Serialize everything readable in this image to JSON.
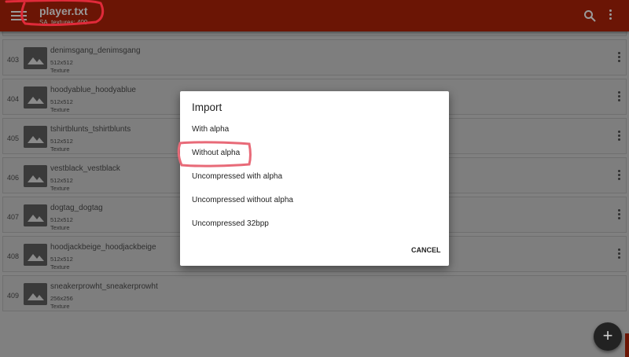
{
  "app_bar": {
    "title": "player.txt",
    "subtitle": "SA_textures: 409",
    "background": "#6b1505"
  },
  "icons": {
    "menu": "menu-icon",
    "search": "search-icon",
    "overflow": "more-vert-icon",
    "thumbnail": "image-icon",
    "fab": "add-icon"
  },
  "items": [
    {
      "index": "403",
      "name": "denimsgang_denimsgang",
      "size": "512x512",
      "type": "Texture"
    },
    {
      "index": "404",
      "name": "hoodyablue_hoodyablue",
      "size": "512x512",
      "type": "Texture"
    },
    {
      "index": "405",
      "name": "tshirtblunts_tshirtblunts",
      "size": "512x512",
      "type": "Texture"
    },
    {
      "index": "406",
      "name": "vestblack_vestblack",
      "size": "512x512",
      "type": "Texture"
    },
    {
      "index": "407",
      "name": "dogtag_dogtag",
      "size": "512x512",
      "type": "Texture"
    },
    {
      "index": "408",
      "name": "hoodjackbeige_hoodjackbeige",
      "size": "512x512",
      "type": "Texture"
    },
    {
      "index": "409",
      "name": "sneakerprowht_sneakerprowht",
      "size": "256x256",
      "type": "Texture"
    }
  ],
  "dialog": {
    "title": "Import",
    "options": [
      "With alpha",
      "Without alpha",
      "Uncompressed with alpha",
      "Uncompressed without alpha",
      "Uncompressed 32bpp"
    ],
    "cancel_label": "CANCEL"
  },
  "fab": {
    "label": "+"
  },
  "annotation_color": "#e02a3a"
}
